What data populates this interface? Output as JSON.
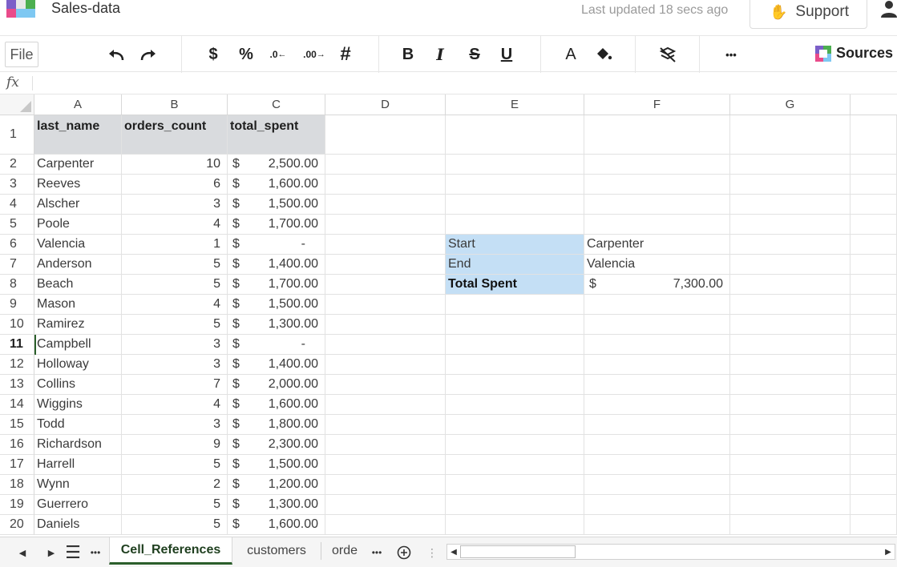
{
  "app": {
    "title": "Sales-data",
    "last_updated": "Last updated 18 secs ago",
    "support_label": "Support"
  },
  "toolbar": {
    "file_label": "File",
    "currency": "$",
    "percent": "%",
    "dec_decrease": ".0",
    "dec_increase": ".00",
    "number_format": "#",
    "bold": "B",
    "italic": "I",
    "strike": "S",
    "underline": "U",
    "text_color": "A",
    "more": "•••",
    "sources_label": "Sources"
  },
  "formula_bar": {
    "fx": "fx",
    "value": ""
  },
  "columns": [
    "A",
    "B",
    "C",
    "D",
    "E",
    "F",
    "G"
  ],
  "header_row": {
    "row": "1",
    "a": "last_name",
    "b": "orders_count",
    "c": "total_spent"
  },
  "rows": [
    {
      "row": "2",
      "last_name": "Carpenter",
      "orders_count": "10",
      "cur": "$",
      "total_spent": "2,500.00"
    },
    {
      "row": "3",
      "last_name": "Reeves",
      "orders_count": "6",
      "cur": "$",
      "total_spent": "1,600.00"
    },
    {
      "row": "4",
      "last_name": "Alscher",
      "orders_count": "3",
      "cur": "$",
      "total_spent": "1,500.00"
    },
    {
      "row": "5",
      "last_name": "Poole",
      "orders_count": "4",
      "cur": "$",
      "total_spent": "1,700.00"
    },
    {
      "row": "6",
      "last_name": "Valencia",
      "orders_count": "1",
      "cur": "$",
      "total_spent": "-"
    },
    {
      "row": "7",
      "last_name": "Anderson",
      "orders_count": "5",
      "cur": "$",
      "total_spent": "1,400.00"
    },
    {
      "row": "8",
      "last_name": "Beach",
      "orders_count": "5",
      "cur": "$",
      "total_spent": "1,700.00"
    },
    {
      "row": "9",
      "last_name": "Mason",
      "orders_count": "4",
      "cur": "$",
      "total_spent": "1,500.00"
    },
    {
      "row": "10",
      "last_name": "Ramirez",
      "orders_count": "5",
      "cur": "$",
      "total_spent": "1,300.00"
    },
    {
      "row": "11",
      "last_name": "Campbell",
      "orders_count": "3",
      "cur": "$",
      "total_spent": "-"
    },
    {
      "row": "12",
      "last_name": "Holloway",
      "orders_count": "3",
      "cur": "$",
      "total_spent": "1,400.00"
    },
    {
      "row": "13",
      "last_name": "Collins",
      "orders_count": "7",
      "cur": "$",
      "total_spent": "2,000.00"
    },
    {
      "row": "14",
      "last_name": "Wiggins",
      "orders_count": "4",
      "cur": "$",
      "total_spent": "1,600.00"
    },
    {
      "row": "15",
      "last_name": "Todd",
      "orders_count": "3",
      "cur": "$",
      "total_spent": "1,800.00"
    },
    {
      "row": "16",
      "last_name": "Richardson",
      "orders_count": "9",
      "cur": "$",
      "total_spent": "2,300.00"
    },
    {
      "row": "17",
      "last_name": "Harrell",
      "orders_count": "5",
      "cur": "$",
      "total_spent": "1,500.00"
    },
    {
      "row": "18",
      "last_name": "Wynn",
      "orders_count": "2",
      "cur": "$",
      "total_spent": "1,200.00"
    },
    {
      "row": "19",
      "last_name": "Guerrero",
      "orders_count": "5",
      "cur": "$",
      "total_spent": "1,300.00"
    },
    {
      "row": "20",
      "last_name": "Daniels",
      "orders_count": "5",
      "cur": "$",
      "total_spent": "1,600.00"
    }
  ],
  "summary": {
    "start_label": "Start",
    "start_value": "Carpenter",
    "end_label": "End",
    "end_value": "Valencia",
    "total_label": "Total Spent",
    "total_cur": "$",
    "total_value": "7,300.00"
  },
  "active_row": "11",
  "sheets": {
    "tabs": [
      "Cell_References",
      "customers",
      "orde"
    ],
    "active": "Cell_References",
    "more": "•••"
  },
  "colors": {
    "header_fill": "#d9dbde",
    "highlight_fill": "#c4dff5",
    "active_tab": "#2b5f2b"
  }
}
